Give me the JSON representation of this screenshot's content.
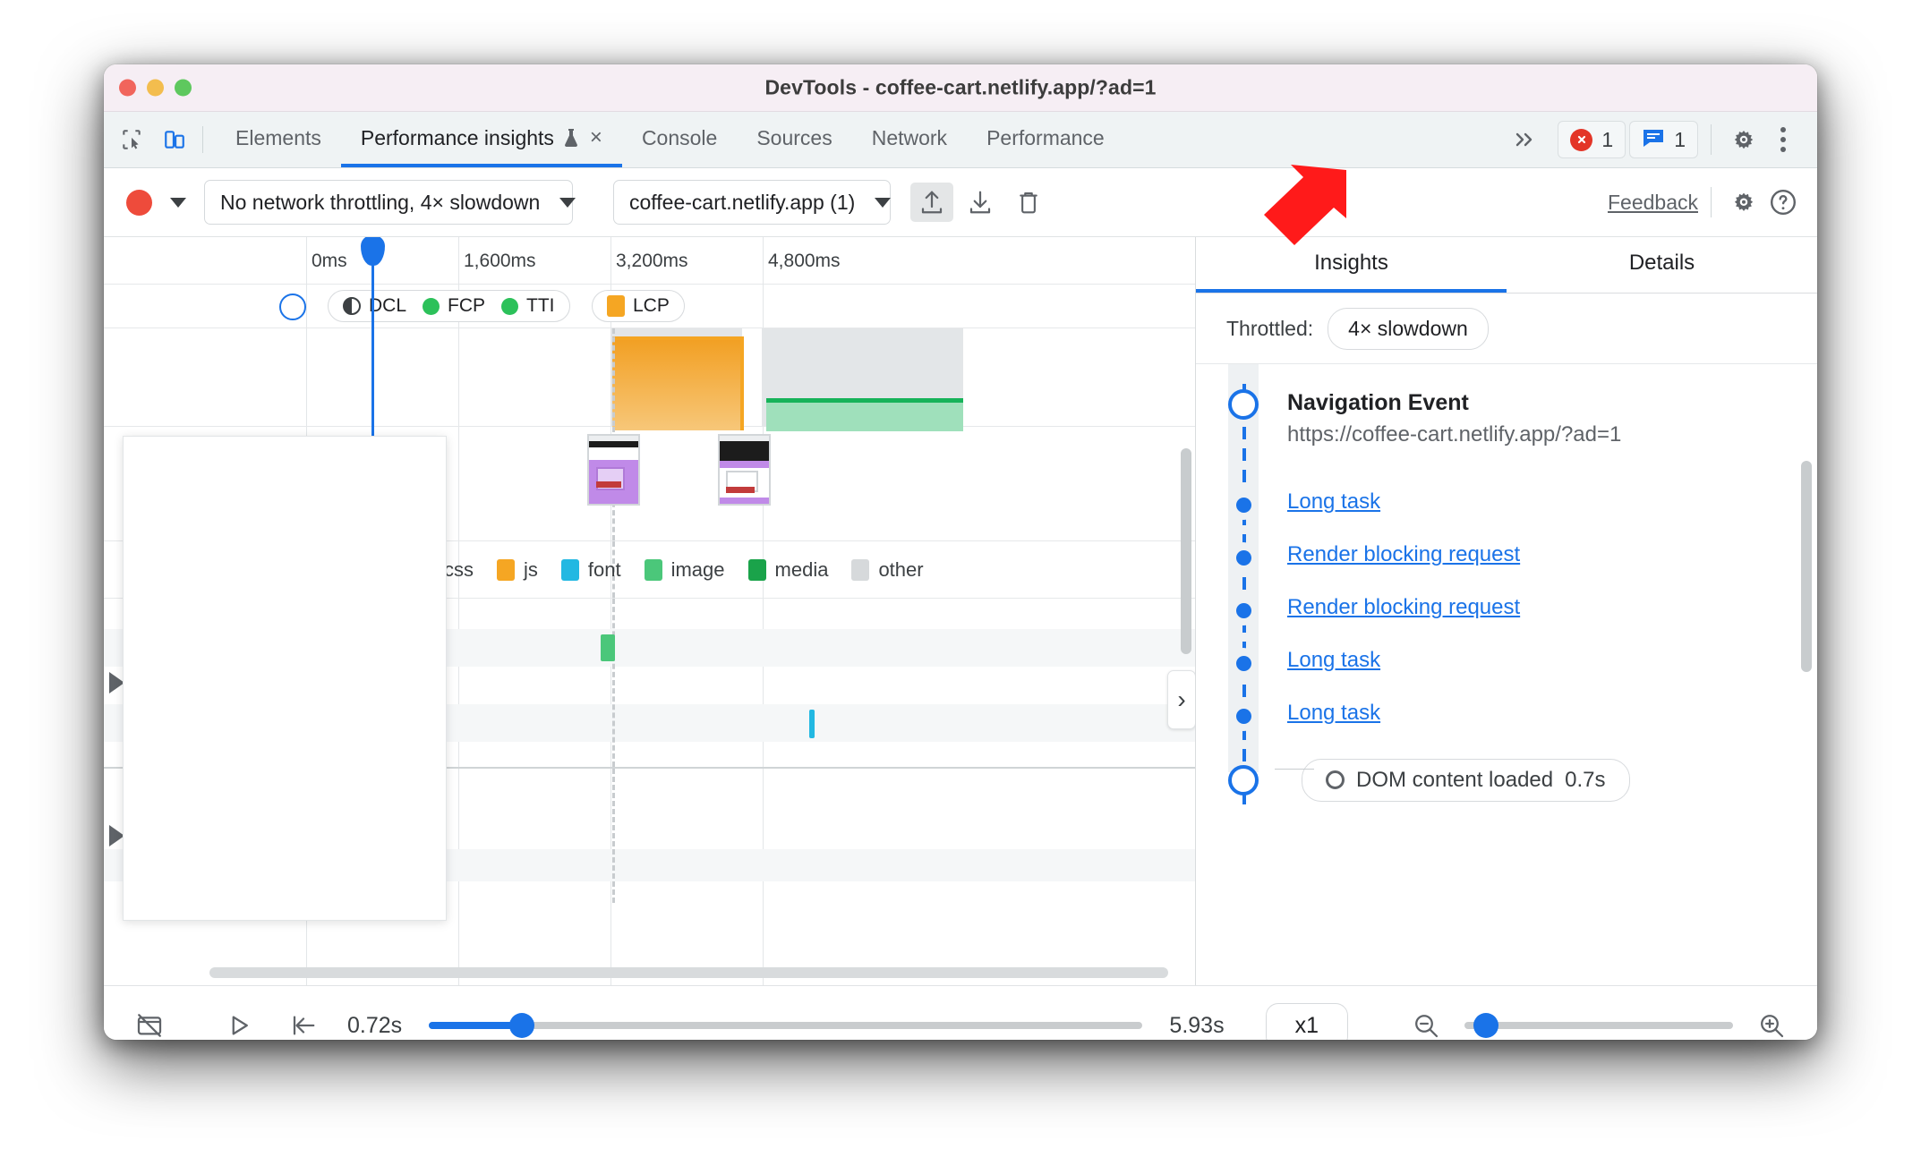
{
  "window": {
    "title": "DevTools - coffee-cart.netlify.app/?ad=1",
    "traffic_lights": [
      "close",
      "minimize",
      "maximize"
    ]
  },
  "tabstrip": {
    "left_icons": [
      "inspect-icon",
      "device-toolbar-icon"
    ],
    "tabs": [
      {
        "label": "Elements",
        "selected": false
      },
      {
        "label": "Performance insights",
        "selected": true,
        "experimental": true,
        "closable": true
      },
      {
        "label": "Console",
        "selected": false
      },
      {
        "label": "Sources",
        "selected": false
      },
      {
        "label": "Network",
        "selected": false
      },
      {
        "label": "Performance",
        "selected": false
      }
    ],
    "more_tabs": "»",
    "tab_close": "×",
    "errors_count": "1",
    "issues_count": "1",
    "settings_icon": "gear-icon",
    "menu_icon": "more-vertical-icon"
  },
  "perfbar": {
    "record_label": "record-button",
    "throttling": "No network throttling, 4× slowdown",
    "page": "coffee-cart.netlify.app (1)",
    "upload_icon": "upload-icon",
    "download_icon": "download-icon",
    "trash_icon": "trash-icon",
    "feedback": "Feedback",
    "settings_icon": "gear-icon",
    "help_icon": "help-icon"
  },
  "timeline": {
    "ticks": [
      "0ms",
      "1,600ms",
      "3,200ms",
      "4,800ms"
    ],
    "markers": [
      {
        "label": "DCL",
        "swatch": "half",
        "color": "#3c4043"
      },
      {
        "label": "FCP",
        "swatch": "dot",
        "color": "#2cc15a"
      },
      {
        "label": "TTI",
        "swatch": "dot",
        "color": "#2cc15a"
      },
      {
        "label": "LCP",
        "swatch": "square",
        "color": "#f5a623"
      }
    ],
    "network_legend": [
      {
        "label": "css",
        "color": "#c08ae8"
      },
      {
        "label": "js",
        "color": "#f5a623"
      },
      {
        "label": "font",
        "color": "#22b8e2"
      },
      {
        "label": "image",
        "color": "#4bc77a"
      },
      {
        "label": "media",
        "color": "#1aa34a"
      },
      {
        "label": "other",
        "color": "#d6d9db"
      }
    ],
    "collapse_handle": "›"
  },
  "sidepanel": {
    "tabs": [
      {
        "label": "Insights",
        "selected": true
      },
      {
        "label": "Details",
        "selected": false
      }
    ],
    "throttled_label": "Throttled:",
    "throttled_value": "4× slowdown",
    "events": [
      {
        "type": "navigation",
        "title": "Navigation Event",
        "subtitle": "https://coffee-cart.netlify.app/?ad=1"
      },
      {
        "type": "link",
        "title": "Long task"
      },
      {
        "type": "link",
        "title": "Render blocking request"
      },
      {
        "type": "link",
        "title": "Render blocking request"
      },
      {
        "type": "link",
        "title": "Long task"
      },
      {
        "type": "link",
        "title": "Long task"
      },
      {
        "type": "milestone",
        "title": "DOM content loaded",
        "time": "0.7s"
      }
    ]
  },
  "bottombar": {
    "screenshots_icon": "screenshots-off-icon",
    "play_icon": "play-icon",
    "jump-to-start_icon": "jump-to-start-icon",
    "start_time": "0.72s",
    "end_time": "5.93s",
    "speed": "x1",
    "zoom_out_icon": "zoom-out-icon",
    "zoom_in_icon": "zoom-in-icon"
  },
  "colors": {
    "accent": "#1a73e8",
    "error": "#e33527",
    "record": "#ee4b3b",
    "cursor": "#ff1a1a",
    "title_bar": "#f6eef4",
    "tab_strip": "#eff3f4"
  }
}
